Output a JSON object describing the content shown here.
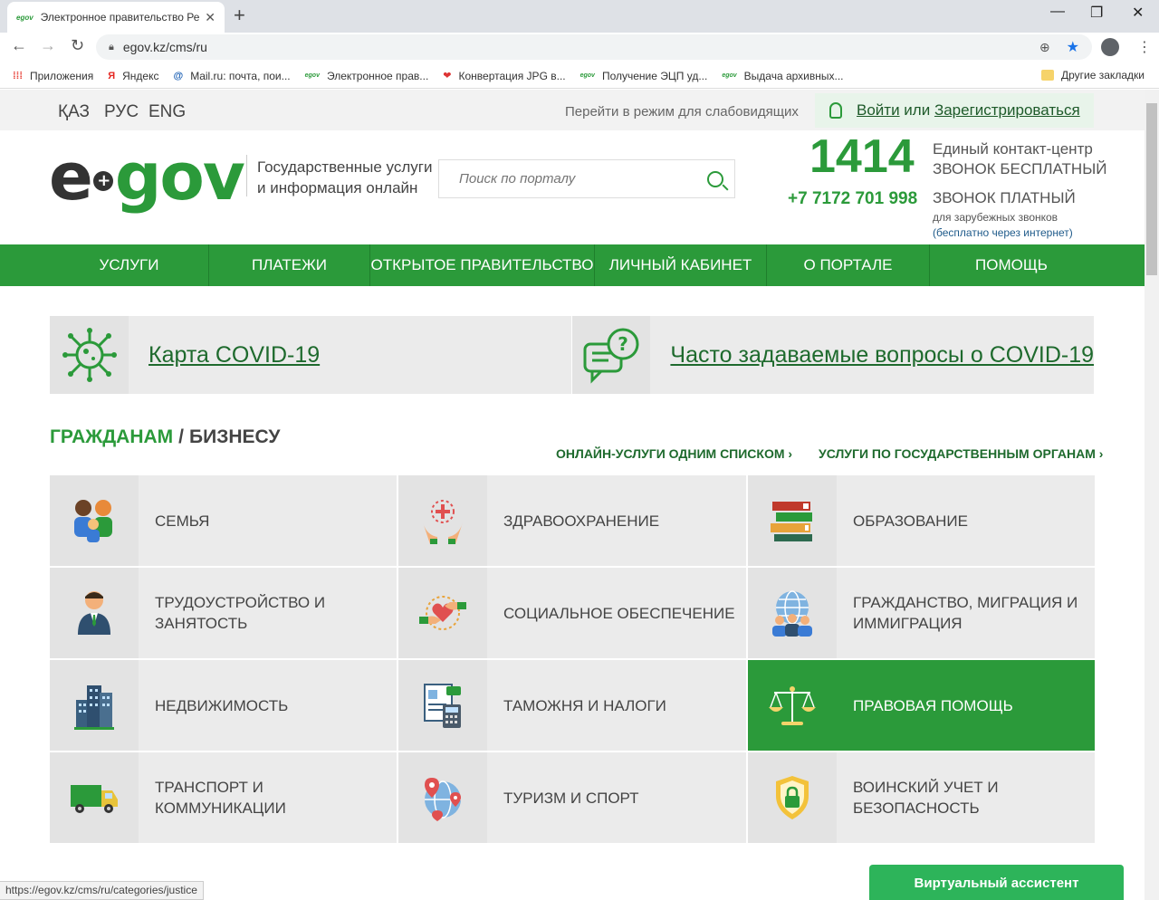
{
  "browser": {
    "tab_title": "Электронное правительство Ре",
    "tab_favicon": "egov",
    "url": "egov.kz/cms/ru",
    "bookmarks": [
      {
        "label": "Приложения",
        "icon": "apps-grid-icon"
      },
      {
        "label": "Яндекс",
        "icon": "yandex-icon"
      },
      {
        "label": "Mail.ru: почта, пои...",
        "icon": "mailru-icon"
      },
      {
        "label": "Электронное прав...",
        "icon": "egov-icon"
      },
      {
        "label": "Конвертация JPG в...",
        "icon": "heart-icon"
      },
      {
        "label": "Получение ЭЦП уд...",
        "icon": "egov-icon"
      },
      {
        "label": "Выдача архивных...",
        "icon": "egov-icon"
      }
    ],
    "other_bookmarks": "Другие закладки",
    "status_url": "https://egov.kz/cms/ru/categories/justice"
  },
  "topbar": {
    "langs": [
      "ҚАЗ",
      "РУС",
      "ENG"
    ],
    "accessibility": "Перейти в режим для слабовидящих",
    "login": "Войти",
    "login_or": " или ",
    "register": "Зарегистрироваться"
  },
  "header": {
    "logo_e": "e",
    "logo_gov": "gov",
    "tagline_1": "Государственные услуги",
    "tagline_2": "и информация онлайн",
    "search_placeholder": "Поиск по порталу",
    "contact_number": "1414",
    "contact_center": "Единый контакт-центр",
    "call_free": "ЗВОНОК БЕСПЛАТНЫЙ",
    "phone": "+7 7172 701 998",
    "call_paid": "ЗВОНОК ПЛАТНЫЙ",
    "foreign_calls": "для зарубежных звонков",
    "free_internet": "(бесплатно через интернет)"
  },
  "nav": [
    "УСЛУГИ",
    "ПЛАТЕЖИ",
    "ОТКРЫТОЕ ПРАВИТЕЛЬСТВО",
    "ЛИЧНЫЙ КАБИНЕТ",
    "О ПОРТАЛЕ",
    "ПОМОЩЬ"
  ],
  "covid": {
    "map": "Карта COVID-19",
    "faq": "Часто задаваемые вопросы о COVID-19"
  },
  "section": {
    "citizens": "ГРАЖДАНАМ",
    "slash": "/",
    "business": "БИЗНЕСУ",
    "link_online": "ОНЛАЙН-УСЛУГИ ОДНИМ СПИСКОМ ›",
    "link_gov": "УСЛУГИ ПО ГОСУДАРСТВЕННЫМ ОРГАНАМ ›"
  },
  "categories": [
    {
      "label": "Семья",
      "icon": "family-icon"
    },
    {
      "label": "Здравоохранение",
      "icon": "healthcare-icon"
    },
    {
      "label": "Образование",
      "icon": "books-icon"
    },
    {
      "label": "Трудоустройство и занятость",
      "icon": "worker-icon"
    },
    {
      "label": "Социальное обеспечение",
      "icon": "heart-hands-icon"
    },
    {
      "label": "Гражданство, миграция и иммиграция",
      "icon": "globe-people-icon"
    },
    {
      "label": "Недвижимость",
      "icon": "buildings-icon"
    },
    {
      "label": "Таможня и налоги",
      "icon": "tax-document-icon"
    },
    {
      "label": "Правовая помощь",
      "icon": "scales-icon",
      "active": true
    },
    {
      "label": "Транспорт и коммуникации",
      "icon": "truck-icon"
    },
    {
      "label": "Туризм и спорт",
      "icon": "globe-pin-icon"
    },
    {
      "label": "Воинский учет и безопасность",
      "icon": "shield-lock-icon"
    }
  ],
  "assistant": "Виртуальный ассистент",
  "colors": {
    "brand_green": "#2b9a3a",
    "dark_green": "#1e6a2d",
    "tile_bg": "#ebebeb"
  }
}
